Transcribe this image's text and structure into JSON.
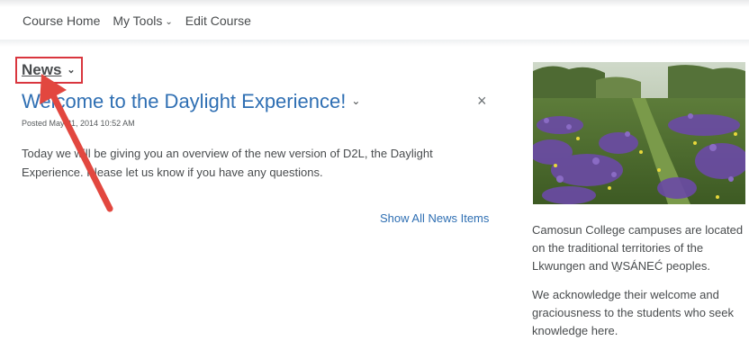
{
  "nav": {
    "items": [
      {
        "label": "Course Home"
      },
      {
        "label": "My Tools",
        "chevron": "⌄"
      },
      {
        "label": "Edit Course"
      }
    ]
  },
  "widget": {
    "title": "News",
    "chevron": "⌄"
  },
  "news_item": {
    "title": "Welcome to the Daylight Experience!",
    "posted": "Posted May 21, 2014 10:52 AM",
    "body": "Today we will be giving you an overview of the new version of D2L, the Daylight Experience. Please let us know if you have any questions.",
    "close_glyph": "×"
  },
  "show_all_label": "Show All News Items",
  "sidebar": {
    "paragraph_1": "Camosun College campuses are located on the traditional territories of the Lkwungen and W̱SÁNEĆ peoples.",
    "paragraph_2": "We acknowledge their welcome and graciousness to the students who seek knowledge here."
  },
  "colors": {
    "link": "#2f6fb3",
    "highlight_box": "#d9363e",
    "arrow": "#e2473f"
  }
}
